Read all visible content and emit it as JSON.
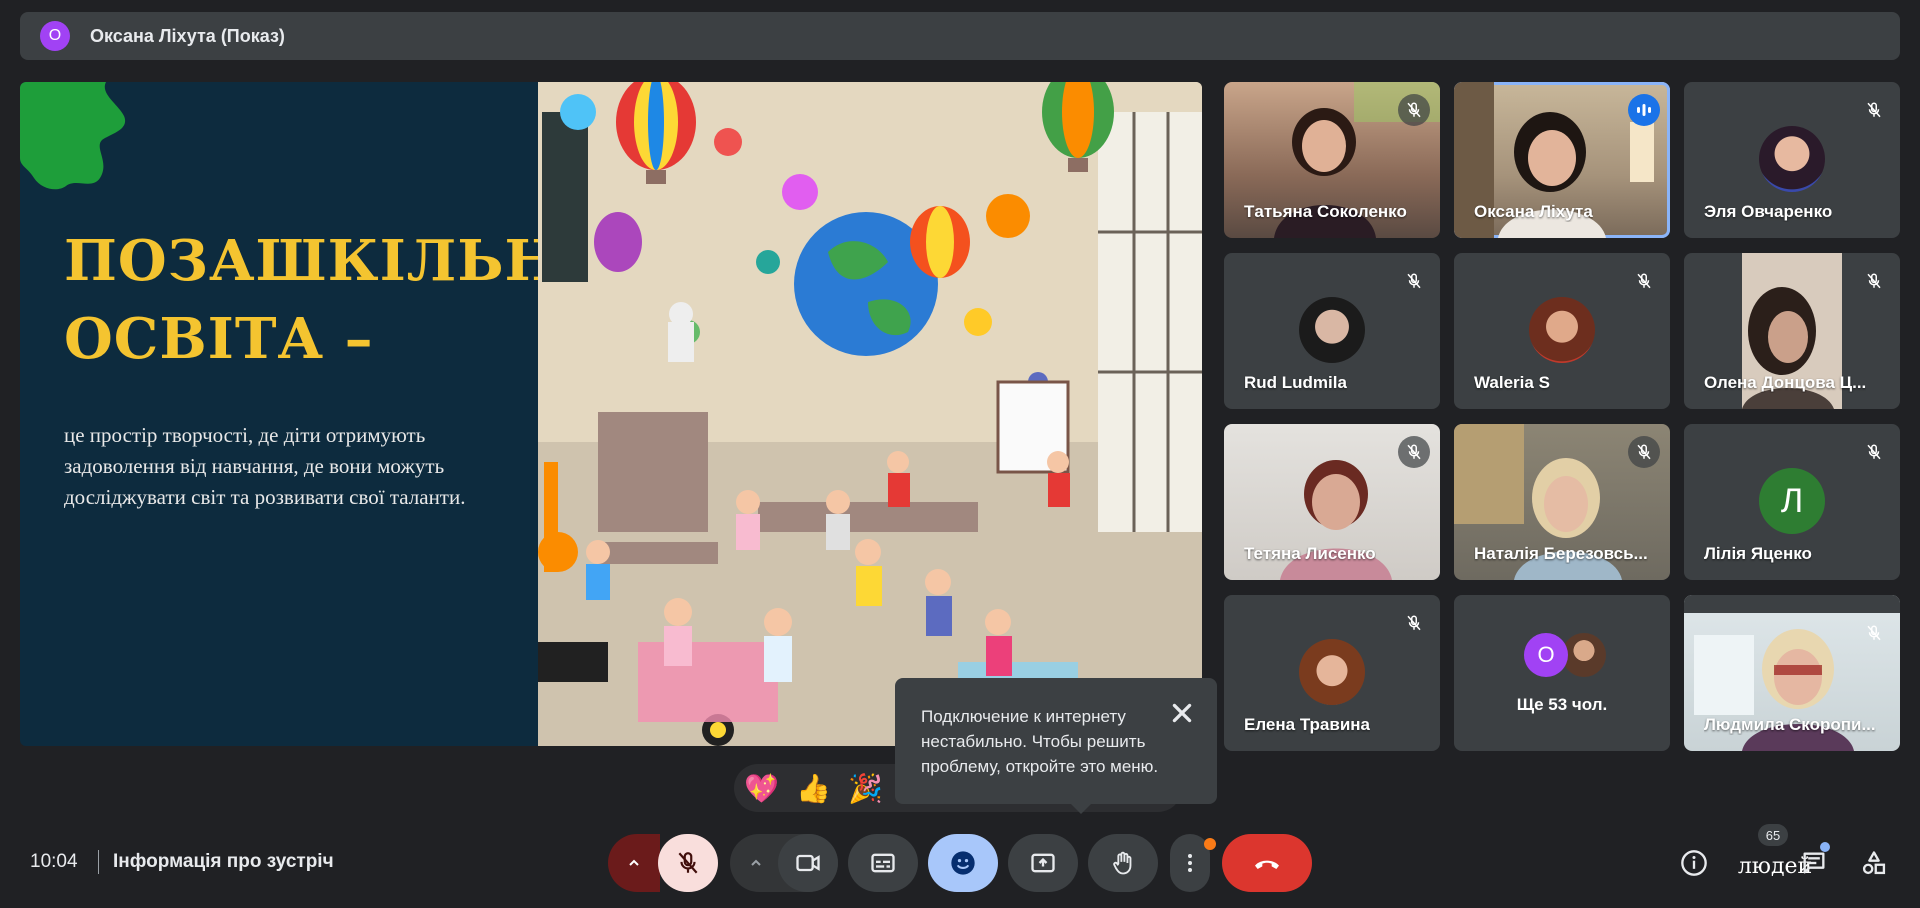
{
  "presenter_bar": {
    "avatar_letter": "О",
    "title": "Оксана Ліхута (Показ)"
  },
  "slide": {
    "heading_line1": "ПОЗАШКІЛЬНА",
    "heading_line2": "ОСВІТА –",
    "body": "це простір творчості, де діти отримують задоволення від навчання, де вони можуть досліджувати світ та розвивати свої таланти.",
    "accent_color": "#f4c430",
    "background_color": "#0d2b3e"
  },
  "participants": [
    {
      "name": "Тaтьяна Соколенко",
      "mic": "muted",
      "type": "video"
    },
    {
      "name": "Оксана Ліхута",
      "mic": "speaking",
      "type": "video",
      "active": true
    },
    {
      "name": "Эля Овчаренко",
      "mic": "muted",
      "type": "avatar"
    },
    {
      "name": "Rud Ludmila",
      "mic": "muted",
      "type": "avatar"
    },
    {
      "name": "Waleria S",
      "mic": "muted",
      "type": "avatar"
    },
    {
      "name": "Олена Донцова Ц...",
      "mic": "muted",
      "type": "video"
    },
    {
      "name": "Тетяна Лисенко",
      "mic": "muted",
      "type": "video"
    },
    {
      "name": "Наталія Березовсь...",
      "mic": "muted",
      "type": "video"
    },
    {
      "name": "Лілія Яценко",
      "mic": "muted",
      "type": "letter",
      "letter": "Л"
    },
    {
      "name": "Елена Травина",
      "mic": "muted",
      "type": "avatar"
    },
    {
      "name": "Ще 53 чол.",
      "type": "more",
      "letter": "О"
    },
    {
      "name": "Людмила Скоропи...",
      "mic": "muted",
      "type": "video"
    }
  ],
  "reactions": [
    "💖",
    "👍",
    "🎉"
  ],
  "tooltip": {
    "text": "Подключение к интернету нестабильно. Чтобы решить проблему, откройте это меню."
  },
  "bottom_bar": {
    "time": "10:04",
    "meeting_info": "Інформація про зустріч",
    "people_label": "людей",
    "people_count": "65"
  }
}
